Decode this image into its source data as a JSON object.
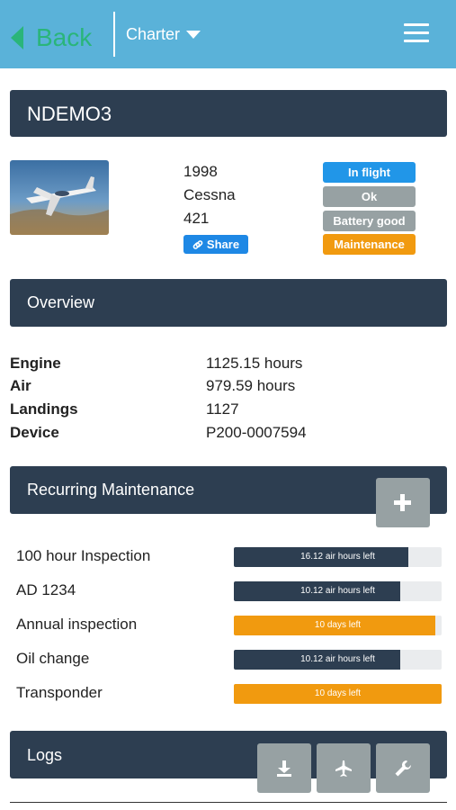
{
  "header": {
    "back_label": "Back",
    "section_label": "Charter",
    "icons": {
      "back": "triangle-left-icon",
      "dropdown": "caret-down-icon",
      "menu": "hamburger-menu-icon"
    },
    "colors": {
      "bar": "#5ab2d9",
      "back": "#2ab57a"
    }
  },
  "aircraft": {
    "tail": "NDEMO3",
    "year": "1998",
    "make": "Cessna",
    "model": "421",
    "share_label": "Share",
    "share_icon": "link-icon",
    "statuses": [
      {
        "label": "In flight",
        "color": "#2196e8"
      },
      {
        "label": "Ok",
        "color": "#97a1a3"
      },
      {
        "label": "Battery good",
        "color": "#97a1a3"
      },
      {
        "label": "Maintenance",
        "color": "#f19a0f"
      }
    ]
  },
  "overview": {
    "title": "Overview",
    "rows": [
      {
        "label": "Engine",
        "value": "1125.15 hours"
      },
      {
        "label": "Air",
        "value": "979.59 hours"
      },
      {
        "label": "Landings",
        "value": "1127"
      },
      {
        "label": "Device",
        "value": "P200-0007594"
      }
    ]
  },
  "maintenance": {
    "title": "Recurring Maintenance",
    "add_icon": "plus-icon",
    "items": [
      {
        "name": "100 hour Inspection",
        "status": "16.12 air hours left",
        "progress": 0.84,
        "color": "#2d3e51"
      },
      {
        "name": "AD 1234",
        "status": "10.12 air hours left",
        "progress": 0.8,
        "color": "#2d3e51"
      },
      {
        "name": "Annual inspection",
        "status": "10 days left",
        "progress": 0.97,
        "color": "#f19a0f"
      },
      {
        "name": "Oil change",
        "status": "10.12 air hours left",
        "progress": 0.8,
        "color": "#2d3e51"
      },
      {
        "name": "Transponder",
        "status": "10 days left",
        "progress": 1.0,
        "color": "#f19a0f"
      }
    ]
  },
  "logs": {
    "title": "Logs",
    "actions": [
      "download-icon",
      "airplane-icon",
      "wrench-icon"
    ]
  }
}
